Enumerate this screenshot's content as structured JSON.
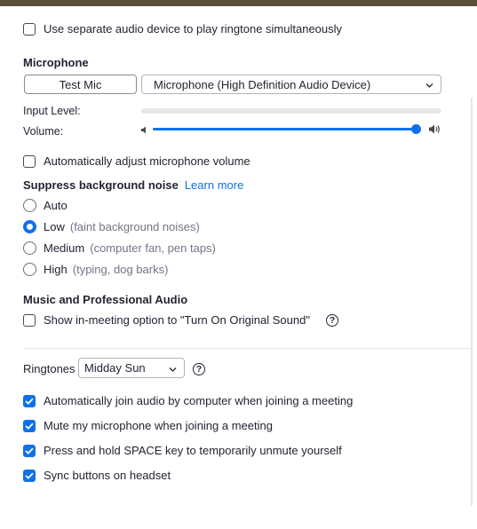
{
  "options": {
    "separate_audio_device": {
      "label": "Use separate audio device to play ringtone simultaneously",
      "checked": false
    }
  },
  "microphone": {
    "heading": "Microphone",
    "test_button": "Test Mic",
    "device": "Microphone (High Definition Audio Device)",
    "input_level_label": "Input Level:",
    "input_level": 0,
    "volume_label": "Volume:",
    "volume": 1.0,
    "auto_adjust": {
      "label": "Automatically adjust microphone volume",
      "checked": false
    }
  },
  "noise": {
    "heading": "Suppress background noise",
    "learn_more": "Learn more",
    "selected": "Low",
    "options": [
      {
        "label": "Auto",
        "hint": ""
      },
      {
        "label": "Low",
        "hint": "(faint background noises)"
      },
      {
        "label": "Medium",
        "hint": "(computer fan, pen taps)"
      },
      {
        "label": "High",
        "hint": "(typing, dog barks)"
      }
    ]
  },
  "music": {
    "heading": "Music and Professional Audio",
    "original_sound": {
      "label": "Show in-meeting option to \"Turn On Original Sound\"",
      "checked": false
    }
  },
  "ringtones": {
    "label": "Ringtones",
    "value": "Midday Sun"
  },
  "bottom_options": [
    {
      "label": "Automatically join audio by computer when joining a meeting",
      "checked": true
    },
    {
      "label": "Mute my microphone when joining a meeting",
      "checked": true
    },
    {
      "label": "Press and hold SPACE key to temporarily unmute yourself",
      "checked": true
    },
    {
      "label": "Sync buttons on headset",
      "checked": true
    }
  ],
  "colors": {
    "accent": "#0e71eb",
    "text": "#232333",
    "hint": "#747487",
    "topbar": "#5b4d3a"
  },
  "icons": {
    "help": "question-circle-icon",
    "dropdown": "chevron-down-icon",
    "volume_low": "speaker-low-icon",
    "volume_high": "speaker-high-icon"
  }
}
